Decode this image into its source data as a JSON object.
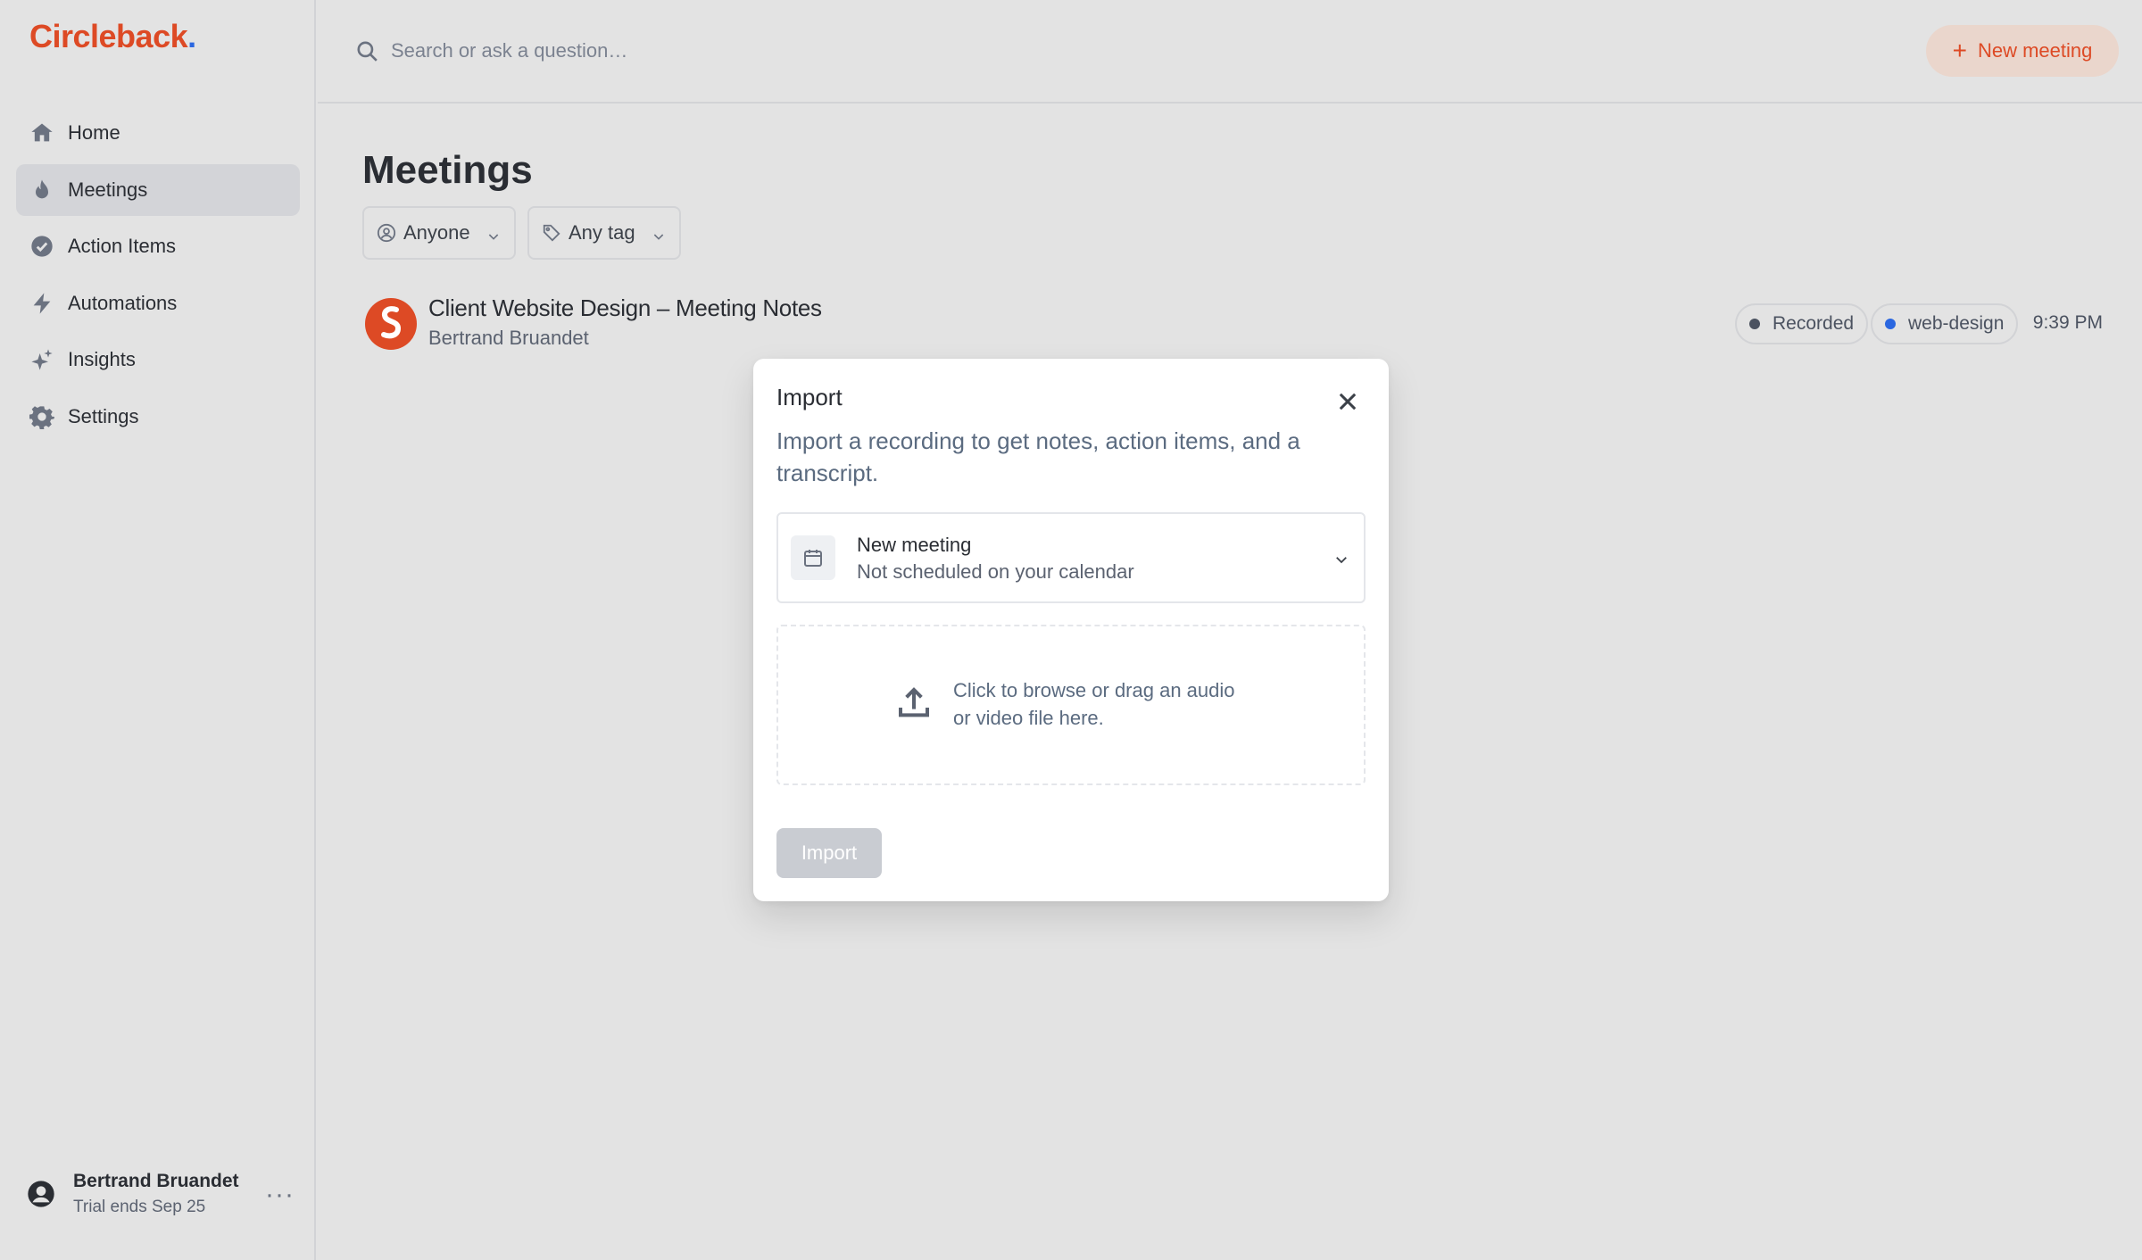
{
  "brand": {
    "name": "Circleback",
    "dot": ".",
    "color": "#dd4a25",
    "dot_color": "#2b67e0"
  },
  "sidebar": {
    "items": [
      {
        "label": "Home",
        "icon": "home-icon",
        "active": false
      },
      {
        "label": "Meetings",
        "icon": "flame-icon",
        "active": true
      },
      {
        "label": "Action Items",
        "icon": "check-circle-icon",
        "active": false
      },
      {
        "label": "Automations",
        "icon": "bolt-icon",
        "active": false
      },
      {
        "label": "Insights",
        "icon": "sparkles-icon",
        "active": false
      },
      {
        "label": "Settings",
        "icon": "gear-icon",
        "active": false
      }
    ],
    "user": {
      "name": "Bertrand Bruandet",
      "trial": "Trial ends Sep 25",
      "more": "···"
    }
  },
  "topbar": {
    "search_placeholder": "Search or ask a question…",
    "new_meeting_label": "New meeting"
  },
  "main": {
    "title": "Meetings",
    "filters": {
      "people": "Anyone",
      "tag": "Any tag"
    },
    "meetings": [
      {
        "title": "Client Website Design – Meeting Notes",
        "owner": "Bertrand Bruandet",
        "status_tag": "Recorded",
        "status_color": "#4b5260",
        "topic_tag": "web-design",
        "topic_color": "#2b67e0",
        "time": "9:39 PM"
      }
    ]
  },
  "modal": {
    "title": "Import",
    "description": "Import a recording to get notes, action items, and a transcript.",
    "select": {
      "title": "New meeting",
      "subtitle": "Not scheduled on your calendar"
    },
    "dropzone_text": "Click to browse or drag an audio or video file here.",
    "import_label": "Import"
  }
}
